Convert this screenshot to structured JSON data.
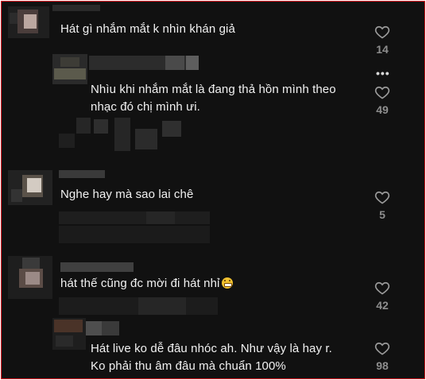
{
  "theme": {
    "background": "#111111",
    "frame_border": "#e31b23",
    "text": "#f1f1f1",
    "count_color": "#8e8e8e"
  },
  "comments": [
    {
      "text": "Hát gì nhắm mắt k nhìn khán giả",
      "likes": "14"
    },
    {
      "line1": "Nhìu khi nhắm mắt là đang thả hồn mình theo",
      "line2": "nhạc đó chị mình ưi.",
      "likes": "49"
    },
    {
      "text": "Nghe hay mà sao lai chê",
      "likes": "5"
    },
    {
      "text": "hát thế cũng đc mời đi hát nhỉ",
      "emoji": "grinning-emoji",
      "likes": "42"
    },
    {
      "line1": "Hát live ko dễ đâu nhóc ah. Như vậy là hay r.",
      "line2": "Ko phải thu âm đâu mà chuẩn 100%",
      "likes": "98"
    }
  ],
  "icons": {
    "like": "heart-icon",
    "more": "more-options-icon"
  }
}
